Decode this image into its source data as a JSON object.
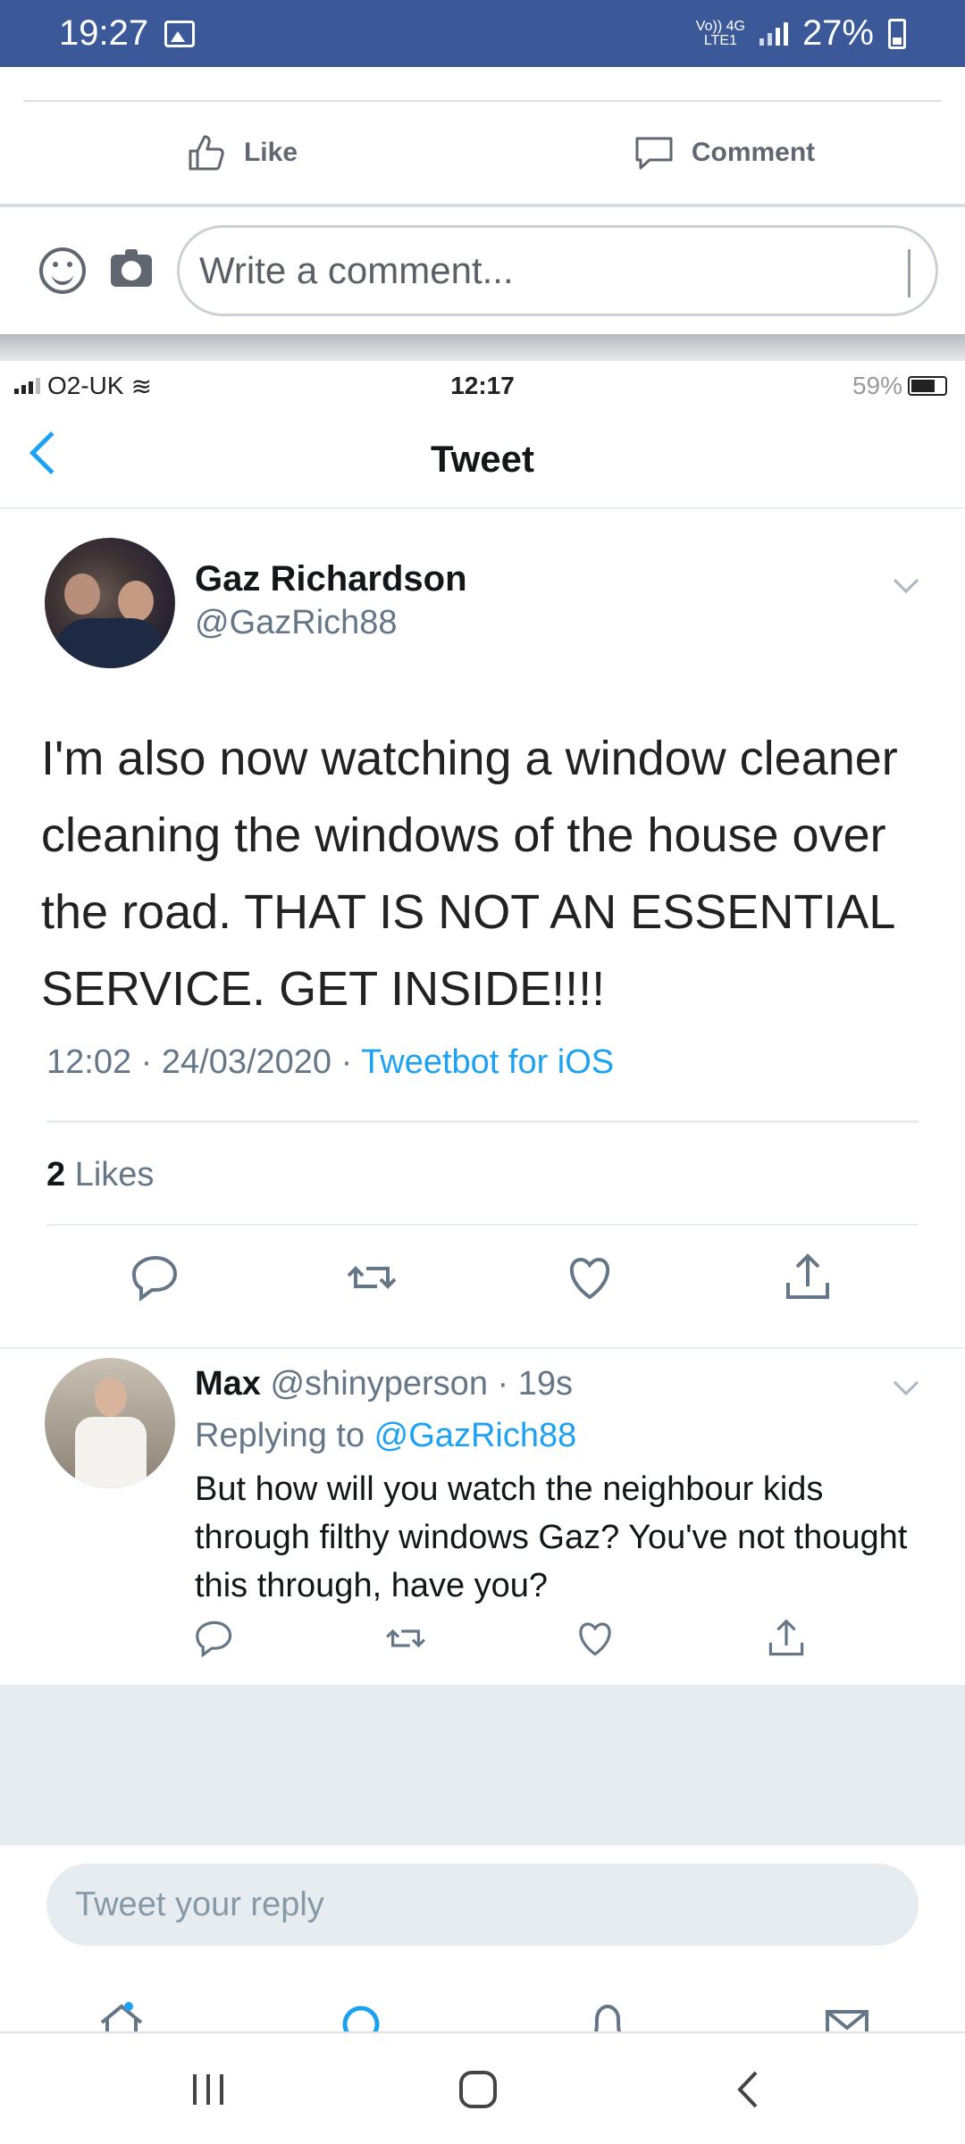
{
  "status_bar": {
    "time": "19:27",
    "network_top": "Vo)) 4G",
    "network_bottom": "LTE1",
    "battery": "27%"
  },
  "facebook": {
    "like_label": "Like",
    "comment_label": "Comment",
    "comment_placeholder": "Write a comment..."
  },
  "screenshot": {
    "ios_status": {
      "carrier": "O2-UK",
      "time": "12:17",
      "battery": "59%"
    },
    "header_title": "Tweet",
    "tweet": {
      "name": "Gaz Richardson",
      "handle": "@GazRich88",
      "text": "I'm also now watching a window cleaner cleaning the windows of the house over the road. THAT IS NOT AN ESSENTIAL SERVICE. GET INSIDE!!!!",
      "timestamp": "12:02 · 24/03/2020 · ",
      "source": "Tweetbot for iOS",
      "likes_count": "2",
      "likes_label": " Likes"
    },
    "reply": {
      "name": "Max",
      "handle_time": " @shinyperson · 19s",
      "replying_prefix": "Replying to ",
      "replying_to": "@GazRich88",
      "text": "But how will you watch the neighbour kids through filthy windows Gaz? You've not thought this through, have you?"
    },
    "reply_placeholder": "Tweet your reply"
  },
  "colors": {
    "facebook_blue": "#3b5998",
    "twitter_blue": "#1da1f2",
    "grey_text": "#657786"
  }
}
